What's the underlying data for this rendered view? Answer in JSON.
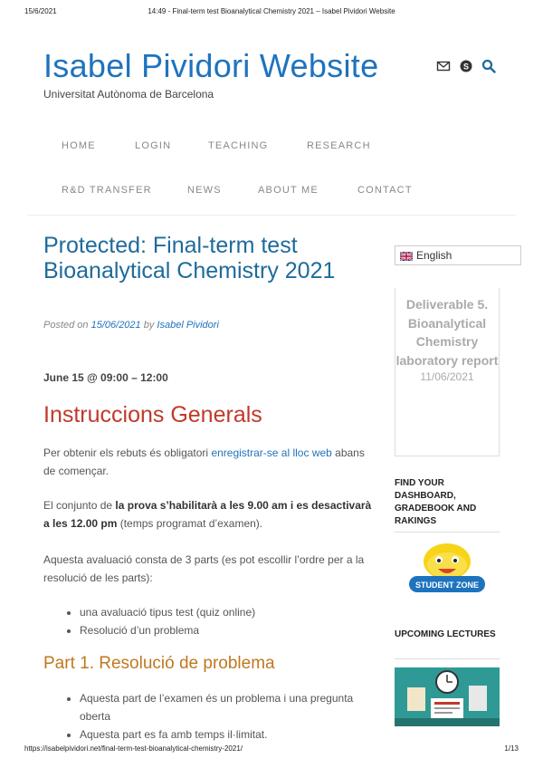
{
  "print_header": {
    "date": "15/6/2021",
    "title": "14:49 - Final-term test Bioanalytical Chemistry 2021 – Isabel Pividori Website"
  },
  "print_footer": {
    "url": "https://isabelpividori.net/final-term-test-bioanalytical-chemistry-2021/",
    "page": "1/13"
  },
  "site": {
    "title": "Isabel Pividori Website",
    "tagline": "Universitat Autònoma de Barcelona"
  },
  "header_icons": [
    "envelope-icon",
    "skype-icon",
    "search-icon"
  ],
  "nav": {
    "items": [
      {
        "label": "HOME"
      },
      {
        "label": "LOGIN"
      },
      {
        "label": "TEACHING"
      },
      {
        "label": "RESEARCH"
      },
      {
        "label": "R&D TRANSFER"
      },
      {
        "label": "NEWS"
      },
      {
        "label": "ABOUT ME"
      },
      {
        "label": "CONTACT"
      }
    ]
  },
  "post": {
    "title": "Protected: Final-term test Bioanalytical Chemistry 2021",
    "meta": {
      "posted_on": "Posted on",
      "date": "15/06/2021",
      "by": "by",
      "author": "Isabel Pividori"
    },
    "date_line": "June 15 @ 09:00 – 12:00",
    "heading": "Instruccions Generals",
    "p1": {
      "before": "Per obtenir els rebuts és obligatori ",
      "link": "enregistrar-se al lloc web",
      "after": " abans de començar."
    },
    "p2": {
      "before": "El conjunto de ",
      "bold": "la prova s’habilitarà a les 9.00 am i es desactivarà a les 12.00 pm",
      "after": " (temps programat d’examen)."
    },
    "p3": "Aquesta avaluació consta de 3 parts (es pot escollir l’ordre per a la resolució de les parts):",
    "list1": [
      "una avaluació tipus test (quiz online)",
      "Resolució d’un problema"
    ],
    "part1_heading": "Part 1. Resolució de problema",
    "list2": [
      "Aquesta part de l’examen és un problema i una pregunta oberta",
      "Aquesta part es fa amb temps il·limitat."
    ]
  },
  "sidebar": {
    "language": "English",
    "deliverable": {
      "title": "Deliverable 5. Bioanalytical Chemistry laboratory report",
      "date": "11/06/2021"
    },
    "find_heading": "FIND YOUR DASHBOARD, GRADEBOOK AND RAKINGS",
    "student_zone": "STUDENT ZONE",
    "upcoming_heading": "UPCOMING LECTURES"
  },
  "colors": {
    "brand": "#1e73be",
    "post_title": "#1e6b9a",
    "heading_red": "#c0392b",
    "heading_orange": "#c0781f",
    "nav_text": "#888888"
  }
}
